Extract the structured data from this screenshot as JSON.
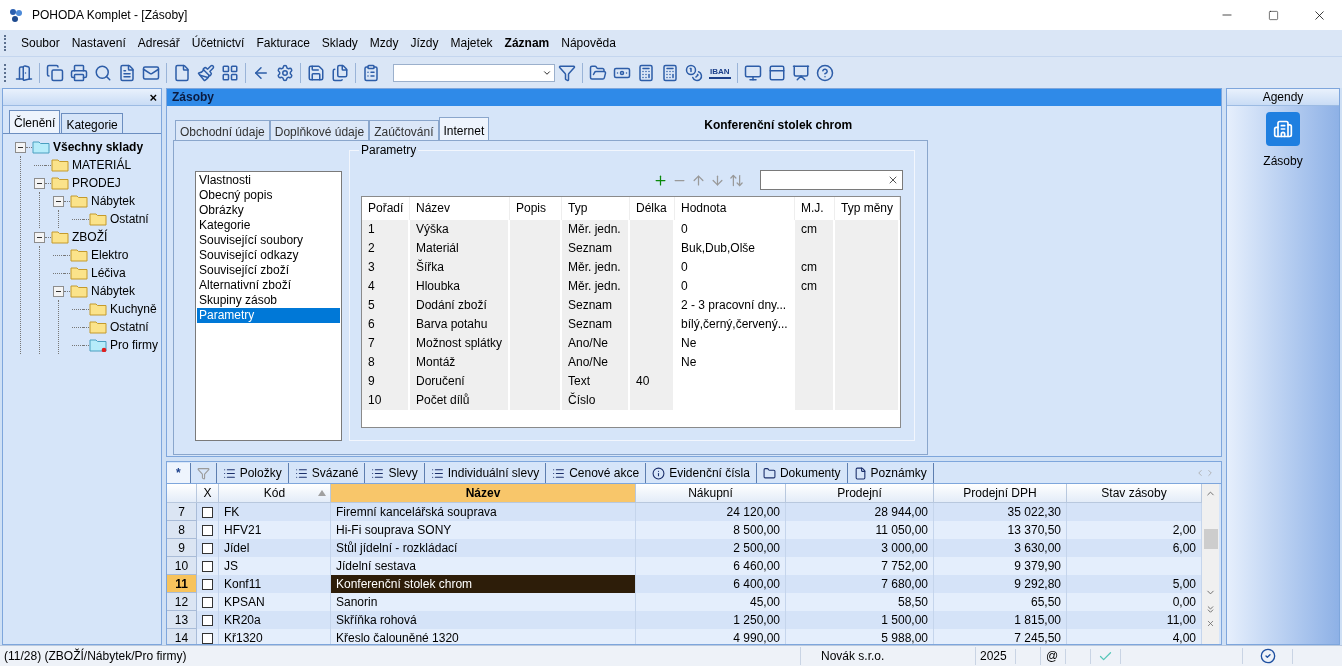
{
  "window": {
    "title": "POHODA Komplet - [Zásoby]"
  },
  "menu": [
    {
      "label": "Soubor",
      "bold": false
    },
    {
      "label": "Nastavení",
      "bold": false
    },
    {
      "label": "Adresář",
      "bold": false
    },
    {
      "label": "Účetnictví",
      "bold": false
    },
    {
      "label": "Fakturace",
      "bold": false
    },
    {
      "label": "Sklady",
      "bold": false
    },
    {
      "label": "Mzdy",
      "bold": false
    },
    {
      "label": "Jízdy",
      "bold": false
    },
    {
      "label": "Majetek",
      "bold": false
    },
    {
      "label": "Záznam",
      "bold": true
    },
    {
      "label": "Nápověda",
      "bold": false
    }
  ],
  "toolbar": {
    "iban_label": "IBAN"
  },
  "left_panel": {
    "close": "×",
    "tabs": [
      {
        "label": "Členění",
        "selected": true
      },
      {
        "label": "Kategorie",
        "selected": false
      }
    ],
    "tree": [
      {
        "label": "Všechny sklady",
        "kind": "root",
        "expanded": true,
        "children": [
          {
            "label": "MATERIÁL",
            "kind": "folder"
          },
          {
            "label": "PRODEJ",
            "kind": "folder",
            "expanded": true,
            "children": [
              {
                "label": "Nábytek",
                "kind": "folder",
                "expanded": true,
                "children": [
                  {
                    "label": "Ostatní",
                    "kind": "folder"
                  }
                ]
              }
            ]
          },
          {
            "label": "ZBOŽÍ",
            "kind": "folder",
            "expanded": true,
            "children": [
              {
                "label": "Elektro",
                "kind": "folder"
              },
              {
                "label": "Léčiva",
                "kind": "folder"
              },
              {
                "label": "Nábytek",
                "kind": "folder",
                "expanded": true,
                "children": [
                  {
                    "label": "Kuchyně",
                    "kind": "folder"
                  },
                  {
                    "label": "Ostatní",
                    "kind": "folder"
                  },
                  {
                    "label": "Pro firmy",
                    "kind": "filter"
                  }
                ]
              }
            ]
          }
        ]
      }
    ]
  },
  "detail": {
    "header": "Zásoby",
    "tabs": [
      {
        "label": "Obchodní údaje",
        "selected": false
      },
      {
        "label": "Doplňkové údaje",
        "selected": false
      },
      {
        "label": "Zaúčtování",
        "selected": false
      },
      {
        "label": "Internet",
        "selected": true
      }
    ],
    "title": "Konferenční stolek chrom",
    "sections": [
      {
        "label": "Vlastnosti",
        "selected": false
      },
      {
        "label": "Obecný popis",
        "selected": false
      },
      {
        "label": "Obrázky",
        "selected": false
      },
      {
        "label": "Kategorie",
        "selected": false
      },
      {
        "label": "Související soubory",
        "selected": false
      },
      {
        "label": "Související odkazy",
        "selected": false
      },
      {
        "label": "Související zboží",
        "selected": false
      },
      {
        "label": "Alternativní zboží",
        "selected": false
      },
      {
        "label": "Skupiny zásob",
        "selected": false
      },
      {
        "label": "Parametry",
        "selected": true
      }
    ],
    "parameters": {
      "title": "Parametry",
      "columns": [
        {
          "label": "Pořadí",
          "editable": false
        },
        {
          "label": "Název",
          "editable": false
        },
        {
          "label": "Popis",
          "editable": false
        },
        {
          "label": "Typ",
          "editable": false
        },
        {
          "label": "Délka",
          "editable": false
        },
        {
          "label": "Hodnota",
          "editable": true
        },
        {
          "label": "M.J.",
          "editable": false
        },
        {
          "label": "Typ měny",
          "editable": false
        }
      ],
      "rows": [
        {
          "order": "1",
          "name": "Výška",
          "type": "Měr. jedn.",
          "value": "0",
          "unit": "cm"
        },
        {
          "order": "2",
          "name": "Materiál",
          "type": "Seznam",
          "value": "Buk,Dub,Olše"
        },
        {
          "order": "3",
          "name": "Šířka",
          "type": "Měr. jedn.",
          "value": "0",
          "unit": "cm"
        },
        {
          "order": "4",
          "name": "Hloubka",
          "type": "Měr. jedn.",
          "value": "0",
          "unit": "cm"
        },
        {
          "order": "5",
          "name": "Dodání zboží",
          "type": "Seznam",
          "value": "2 - 3 pracovní dny..."
        },
        {
          "order": "6",
          "name": "Barva potahu",
          "type": "Seznam",
          "value": "bílý,černý,červený..."
        },
        {
          "order": "7",
          "name": "Možnost splátky",
          "type": "Ano/Ne",
          "value": "Ne"
        },
        {
          "order": "8",
          "name": "Montáž",
          "type": "Ano/Ne",
          "value": "Ne"
        },
        {
          "order": "9",
          "name": "Doručení",
          "type": "Text",
          "length": "40"
        },
        {
          "order": "10",
          "name": "Počet dílů",
          "type": "Číslo"
        }
      ]
    }
  },
  "grid": {
    "tabs": [
      {
        "label": "*",
        "kind": "star",
        "selected": true
      },
      {
        "label": "Položky",
        "kind": "list",
        "selected": false
      },
      {
        "label": "Svázané",
        "kind": "list",
        "selected": false
      },
      {
        "label": "Slevy",
        "kind": "list",
        "selected": false
      },
      {
        "label": "Individuální slevy",
        "kind": "list",
        "selected": false
      },
      {
        "label": "Cenové akce",
        "kind": "list",
        "selected": false
      },
      {
        "label": "Evidenční čísla",
        "kind": "info",
        "selected": false
      },
      {
        "label": "Dokumenty",
        "kind": "folder",
        "selected": false
      },
      {
        "label": "Poznámky",
        "kind": "page",
        "selected": false
      }
    ],
    "columns": [
      {
        "label": "X",
        "sorted": false,
        "selected": false
      },
      {
        "label": "Kód",
        "sorted": true,
        "selected": false
      },
      {
        "label": "Název",
        "sorted": false,
        "selected": true
      },
      {
        "label": "Nákupní",
        "sorted": false,
        "selected": false
      },
      {
        "label": "Prodejní",
        "sorted": false,
        "selected": false
      },
      {
        "label": "Prodejní DPH",
        "sorted": false,
        "selected": false
      },
      {
        "label": "Stav zásoby",
        "sorted": false,
        "selected": false
      }
    ],
    "rows": [
      {
        "number": "7",
        "checked": false,
        "selected": false,
        "code": "FK",
        "name": "Firemní kancelářská souprava",
        "purchase": "24 120,00",
        "sale": "28 944,00",
        "sale_vat": "35 022,30"
      },
      {
        "number": "8",
        "checked": false,
        "selected": false,
        "code": "HFV21",
        "name": "Hi-Fi souprava SONY",
        "purchase": "8 500,00",
        "sale": "11 050,00",
        "sale_vat": "13 370,50",
        "stock": "2,00"
      },
      {
        "number": "9",
        "checked": false,
        "selected": false,
        "code": "Jídel",
        "name": "Stůl jídelní - rozkládací",
        "purchase": "2 500,00",
        "sale": "3 000,00",
        "sale_vat": "3 630,00",
        "stock": "6,00"
      },
      {
        "number": "10",
        "checked": false,
        "selected": false,
        "code": "JS",
        "name": "Jídelní sestava",
        "purchase": "6 460,00",
        "sale": "7 752,00",
        "sale_vat": "9 379,90"
      },
      {
        "number": "11",
        "checked": false,
        "selected": true,
        "code": "Konf11",
        "name": "Konferenční stolek chrom",
        "purchase": "6 400,00",
        "sale": "7 680,00",
        "sale_vat": "9 292,80",
        "stock": "5,00"
      },
      {
        "number": "12",
        "checked": false,
        "selected": false,
        "code": "KPSAN",
        "name": "Sanorin",
        "purchase": "45,00",
        "sale": "58,50",
        "sale_vat": "65,50",
        "stock": "0,00"
      },
      {
        "number": "13",
        "checked": false,
        "selected": false,
        "code": "KR20a",
        "name": "Skříňka rohová",
        "purchase": "1 250,00",
        "sale": "1 500,00",
        "sale_vat": "1 815,00",
        "stock": "11,00"
      },
      {
        "number": "14",
        "checked": false,
        "selected": false,
        "code": "Kř1320",
        "name": "Křeslo čalouněné 1320",
        "purchase": "4 990,00",
        "sale": "5 988,00",
        "sale_vat": "7 245,50",
        "stock": "4,00"
      }
    ]
  },
  "agendas": {
    "title": "Agendy",
    "items": [
      {
        "label": "Zásoby"
      }
    ]
  },
  "status_bar": {
    "record": "(11/28) (ZBOŽÍ/Nábytek/Pro firmy)",
    "company": "Novák s.r.o.",
    "year": "2025",
    "email": "@"
  }
}
